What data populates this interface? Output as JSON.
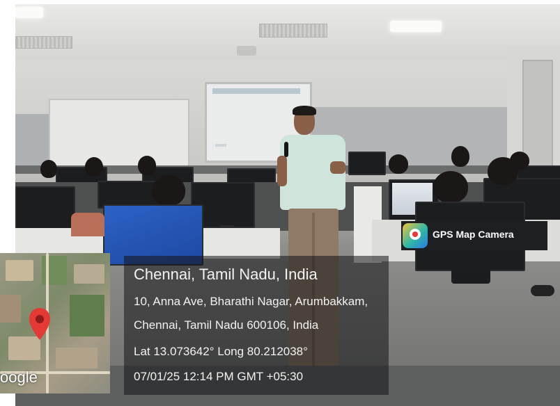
{
  "overlay": {
    "city_line": "Chennai, Tamil Nadu, India",
    "address_line1": "10, Anna Ave, Bharathi Nagar, Arumbakkam,",
    "address_line2": "Chennai, Tamil Nadu 600106, India",
    "coordinates": "Lat 13.073642° Long 80.212038°",
    "timestamp": "07/01/25 12:14 PM GMT +05:30",
    "map_brand": "oogle",
    "app_badge": "GPS Map Camera"
  },
  "icons": {
    "map_pin": "map-pin-icon",
    "app_logo": "gps-map-camera-icon"
  },
  "colors": {
    "pin": "#e53935",
    "caption_text": "#f2f2f2",
    "badge_bg": "#1e1f22"
  }
}
